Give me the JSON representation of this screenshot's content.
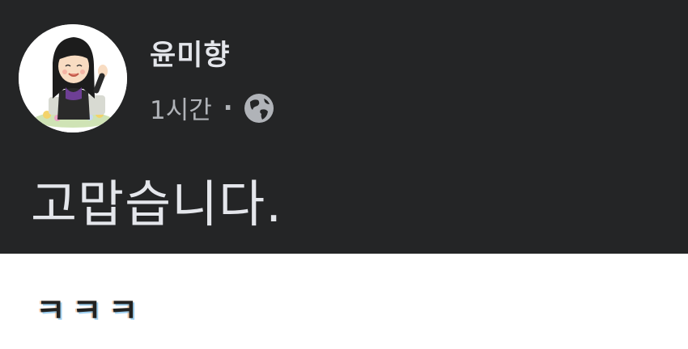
{
  "post": {
    "author_name": "윤미향",
    "timestamp": "1시간",
    "separator": "·",
    "privacy_icon": "globe-icon",
    "message": "고맙습니다."
  },
  "reply": {
    "text": "ㅋㅋㅋ"
  },
  "colors": {
    "post_background": "#242526",
    "primary_text": "#e4e6eb",
    "secondary_text": "#b0b3b8",
    "page_background": "#ffffff"
  }
}
